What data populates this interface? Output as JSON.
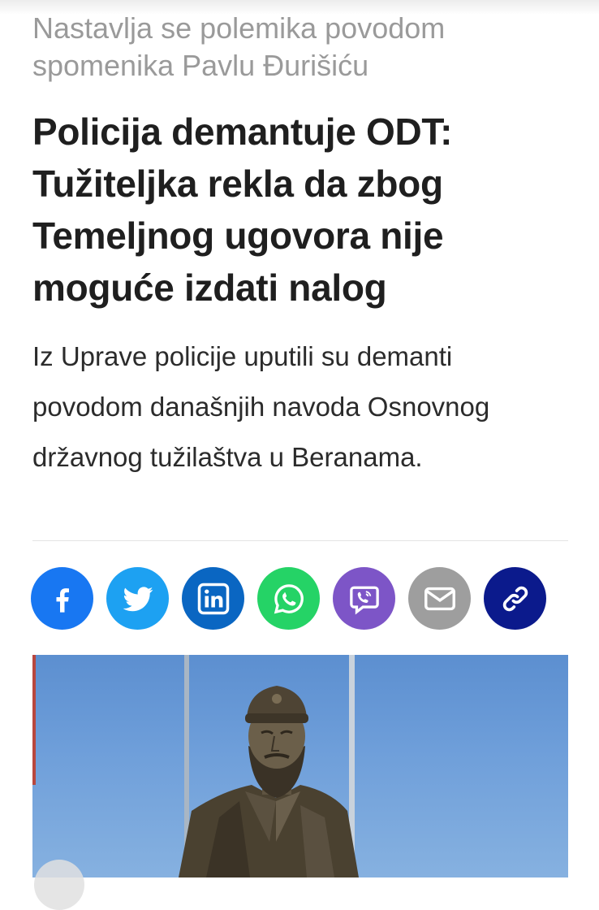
{
  "article": {
    "kicker": "Nastavlja se polemika povodom spomenika Pavlu Đurišiću",
    "headline": "Policija demantuje ODT: Tužiteljka rekla da zbog Temeljnog ugovora nije moguće izdati nalog",
    "lead": "Iz Uprave policije uputili su demanti povodom današnjih navoda Osnovnog državnog tužilaštva u Beranama."
  },
  "share": {
    "buttons": [
      {
        "network": "facebook",
        "icon": "facebook-icon",
        "color": "#1877f2"
      },
      {
        "network": "twitter",
        "icon": "twitter-bird-icon",
        "color": "#1da1f2"
      },
      {
        "network": "linkedin",
        "icon": "linkedin-icon",
        "color": "#0a66c2"
      },
      {
        "network": "whatsapp",
        "icon": "whatsapp-icon",
        "color": "#25d366"
      },
      {
        "network": "viber",
        "icon": "viber-icon",
        "color": "#7d55c7"
      },
      {
        "network": "email",
        "icon": "envelope-icon",
        "color": "#9e9e9e"
      },
      {
        "network": "copy-link",
        "icon": "link-icon",
        "color": "#0b1a8c"
      }
    ]
  },
  "image": {
    "subject": "bronze statue",
    "sky_color": "#6f9fda"
  }
}
